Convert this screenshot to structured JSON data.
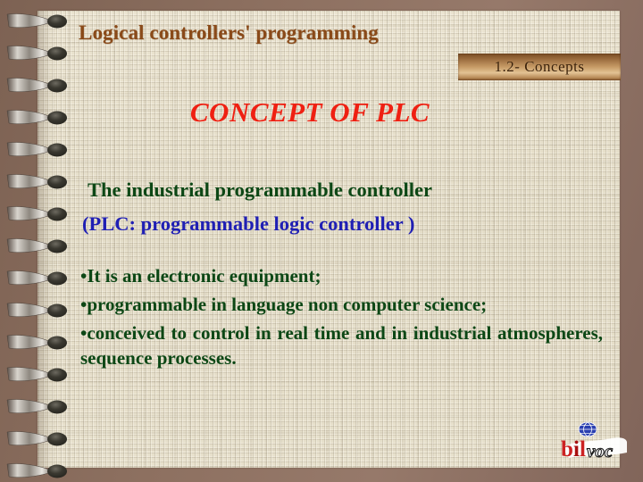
{
  "slide": {
    "header_title": "Logical controllers' programming",
    "section_badge": "1.2- Concepts",
    "main_heading": "CONCEPT OF PLC",
    "definition_line_1": "The industrial programmable controller",
    "definition_line_2": "(PLC: programmable logic controller )",
    "bullets": [
      "•It is an electronic equipment;",
      "•programmable in language non computer science;",
      "•conceived to control in real time and in industrial atmospheres, sequence processes."
    ],
    "logo": {
      "text_primary": "bil",
      "text_secondary": "voc",
      "globe_icon": "globe-icon"
    },
    "colors": {
      "header_title": "#8a4a19",
      "badge_text": "#3a2008",
      "main_heading": "#ef2012",
      "definition_green": "#0c4715",
      "definition_blue": "#1f1fb4",
      "bullet_green": "#0c4715",
      "paper": "#e6dfcb",
      "backdrop": "#8a6d5c",
      "logo_red": "#cc2222",
      "logo_blue": "#2a3fb0"
    }
  }
}
